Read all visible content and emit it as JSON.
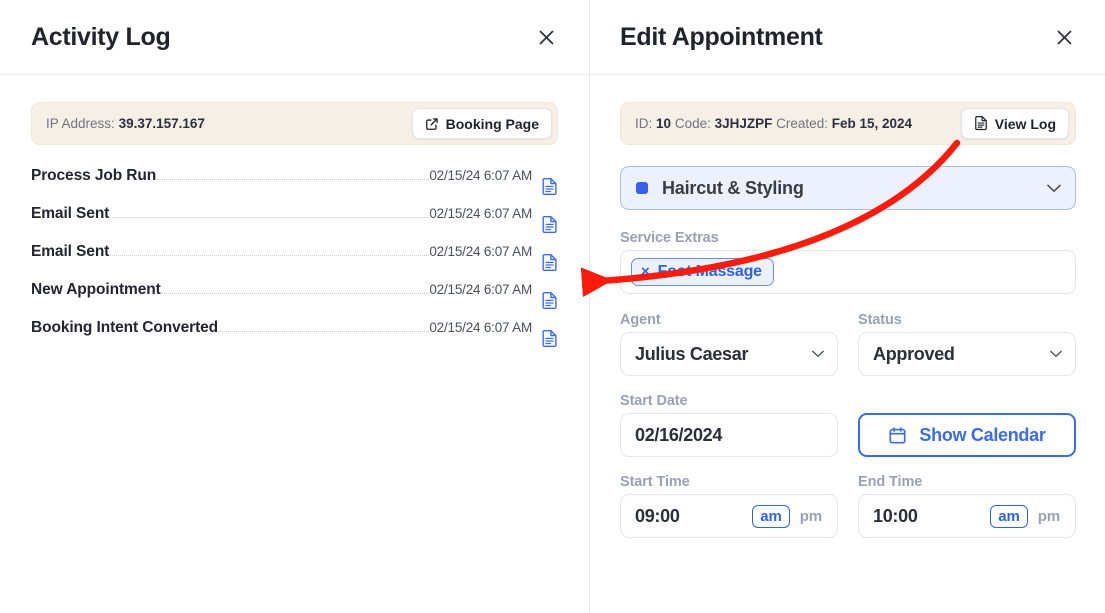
{
  "activity_panel": {
    "title": "Activity Log",
    "close_icon": "close-icon",
    "info": {
      "label": "IP Address:",
      "value": "39.37.157.167",
      "button_label": "Booking Page",
      "button_icon": "external-link-icon"
    },
    "rows": [
      {
        "label": "Process Job Run",
        "time": "02/15/24 6:07 AM",
        "icon": "document-icon"
      },
      {
        "label": "Email Sent",
        "time": "02/15/24 6:07 AM",
        "icon": "document-icon"
      },
      {
        "label": "Email Sent",
        "time": "02/15/24 6:07 AM",
        "icon": "document-icon"
      },
      {
        "label": "New Appointment",
        "time": "02/15/24 6:07 AM",
        "icon": "document-icon"
      },
      {
        "label": "Booking Intent Converted",
        "time": "02/15/24 6:07 AM",
        "icon": "document-icon"
      }
    ]
  },
  "edit_panel": {
    "title": "Edit Appointment",
    "close_icon": "close-icon",
    "meta": {
      "id_label": "ID:",
      "id_value": "10",
      "code_label": "Code:",
      "code_value": "3JHJZPF",
      "created_label": "Created:",
      "created_value": "Feb 15, 2024",
      "button_label": "View Log",
      "button_icon": "document-icon"
    },
    "service": {
      "value": "Haircut & Styling",
      "swatch_color": "#3761e8"
    },
    "service_extras": {
      "label": "Service Extras",
      "chips": [
        {
          "remove": "×",
          "label": "Foot Massage"
        }
      ]
    },
    "agent": {
      "label": "Agent",
      "value": "Julius Caesar"
    },
    "status": {
      "label": "Status",
      "value": "Approved"
    },
    "start_date": {
      "label": "Start Date",
      "value": "02/16/2024"
    },
    "calendar_button": {
      "label": "Show Calendar",
      "icon": "calendar-icon"
    },
    "start_time": {
      "label": "Start Time",
      "value": "09:00",
      "am": "am",
      "pm": "pm",
      "selected": "am"
    },
    "end_time": {
      "label": "End Time",
      "value": "10:00",
      "am": "am",
      "pm": "pm",
      "selected": "am"
    }
  },
  "annotation": {
    "type": "curved-arrow",
    "color": "#f91c0c",
    "from": "view-log-button",
    "to": "activity-row-3-document-icon"
  },
  "colors": {
    "accent_blue": "#3b6bf0",
    "info_bar_bg": "#f6efe6",
    "service_bg": "#edf0fd",
    "label_gray": "#9aa1b4",
    "annotation_red": "#f91c0c"
  }
}
